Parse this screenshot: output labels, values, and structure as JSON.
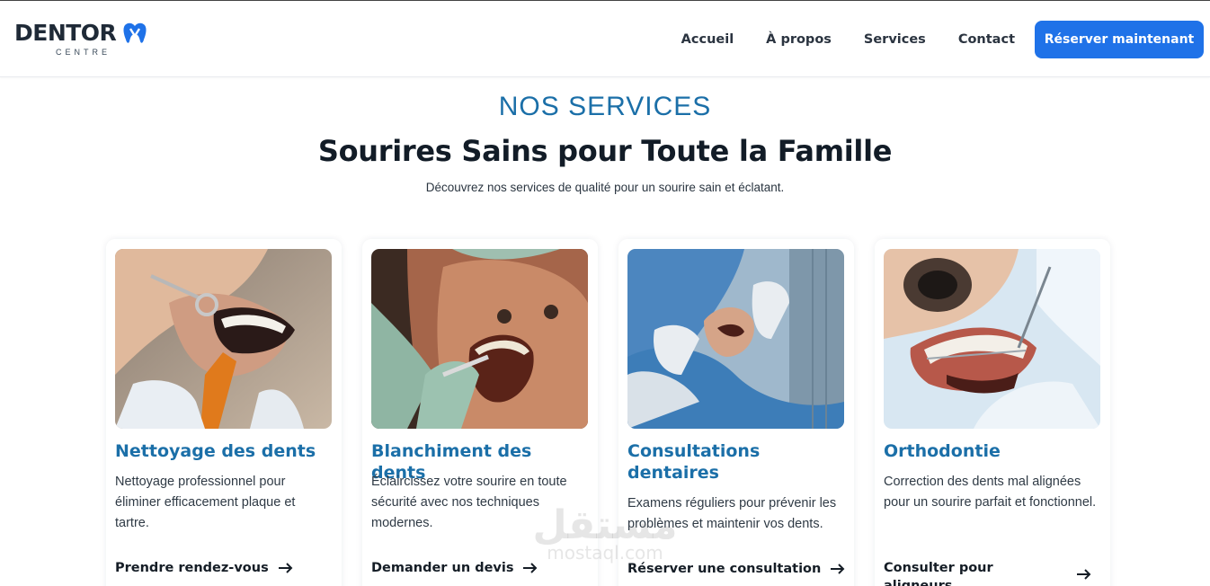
{
  "brand": {
    "name": "DENTOR",
    "sub": "CENTRE",
    "icon": "tooth-icon",
    "color": "#1f72e8"
  },
  "nav": {
    "links": [
      "Accueil",
      "À propos",
      "Services",
      "Contact"
    ],
    "cta": "Réserver maintenant"
  },
  "services": {
    "eyebrow": "NOS SERVICES",
    "title": "Sourires Sains pour Toute la Famille",
    "subtitle": "Découvrez nos services de qualité pour un sourire sain et éclatant.",
    "cards": [
      {
        "title": "Nettoyage des dents",
        "description": "Nettoyage professionnel pour éliminer efficacement plaque et tartre.",
        "link": "Prendre rendez-vous",
        "image": "teeth-cleaning-photo"
      },
      {
        "title": "Blanchiment des dents",
        "description": "Éclaircissez votre sourire en toute sécurité avec nos techniques modernes.",
        "link": "Demander un devis",
        "image": "teeth-whitening-photo"
      },
      {
        "title": "Consultations dentaires",
        "description": "Examens réguliers pour prévenir les problèmes et maintenir vos dents.",
        "link": "Réserver une consultation",
        "image": "dental-consultation-photo"
      },
      {
        "title": "Orthodontie",
        "description": "Correction des dents mal alignées pour un sourire parfait et fonctionnel.",
        "link": "Consulter pour aligneurs",
        "image": "orthodontics-braces-photo"
      }
    ]
  },
  "watermark": {
    "arabic": "مستقل",
    "latin": "mostaql.com"
  },
  "colors": {
    "accent": "#1b6fa8",
    "button": "#1f72e8",
    "heading": "#121c27"
  }
}
